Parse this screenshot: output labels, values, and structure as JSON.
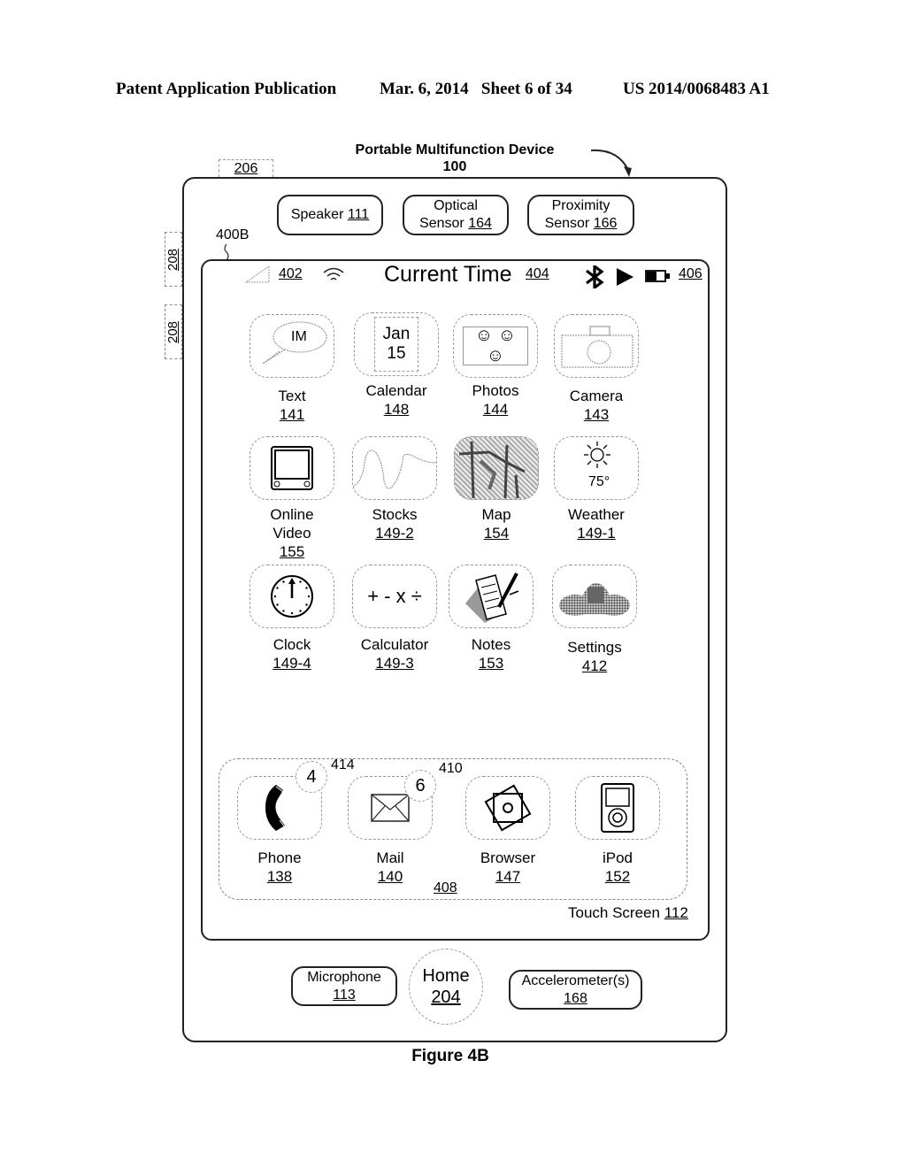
{
  "header": {
    "publication": "Patent Application Publication",
    "date_sheet": "Mar. 6, 2014   Sheet 6 of 34",
    "pub_number": "US 2014/0068483 A1"
  },
  "device": {
    "title": "Portable Multifunction Device",
    "ref": "100",
    "ref_206": "206",
    "side_buttons": [
      "208",
      "208"
    ],
    "screen_ref": "400B",
    "sensors": [
      {
        "line1": "Speaker",
        "ref": "111"
      },
      {
        "line1": "Optical",
        "line2": "Sensor",
        "ref": "164"
      },
      {
        "line1": "Proximity",
        "line2": "Sensor",
        "ref": "166"
      }
    ]
  },
  "status_bar": {
    "signal_ref": "402",
    "time_label": "Current Time",
    "time_ref": "404",
    "battery_ref": "406",
    "icons": [
      "signal-icon",
      "wifi-icon",
      "bluetooth-icon",
      "play-icon",
      "battery-icon"
    ]
  },
  "apps": [
    {
      "name": "Text",
      "ref": "141",
      "icon": "im-bubble-icon",
      "icon_text": "IM"
    },
    {
      "name": "Calendar",
      "ref": "148",
      "icon": "calendar-icon",
      "icon_text": "Jan",
      "icon_text2": "15"
    },
    {
      "name": "Photos",
      "ref": "144",
      "icon": "photos-icon",
      "icon_text": "☺ ☺ ☺"
    },
    {
      "name": "Camera",
      "ref": "143",
      "icon": "camera-icon"
    },
    {
      "name": "Online Video",
      "name1": "Online",
      "name2": "Video",
      "ref": "155",
      "icon": "video-icon"
    },
    {
      "name": "Stocks",
      "ref": "149-2",
      "icon": "stocks-icon"
    },
    {
      "name": "Map",
      "ref": "154",
      "icon": "map-icon"
    },
    {
      "name": "Weather",
      "ref": "149-1",
      "icon": "weather-icon",
      "icon_text": "75°"
    },
    {
      "name": "Clock",
      "ref": "149-4",
      "icon": "clock-icon"
    },
    {
      "name": "Calculator",
      "ref": "149-3",
      "icon": "calculator-icon",
      "icon_text": "+ - x ÷"
    },
    {
      "name": "Notes",
      "ref": "153",
      "icon": "notes-icon"
    },
    {
      "name": "Settings",
      "ref": "412",
      "icon": "settings-icon"
    }
  ],
  "dock": {
    "ref": "408",
    "apps": [
      {
        "name": "Phone",
        "ref": "138",
        "icon": "phone-icon",
        "badge": "4",
        "badge_ref": "414"
      },
      {
        "name": "Mail",
        "ref": "140",
        "icon": "mail-icon",
        "badge": "6",
        "badge_ref": "410"
      },
      {
        "name": "Browser",
        "ref": "147",
        "icon": "browser-icon"
      },
      {
        "name": "iPod",
        "ref": "152",
        "icon": "ipod-icon"
      }
    ]
  },
  "touch_screen": {
    "label": "Touch Screen",
    "ref": "112"
  },
  "bottom": {
    "microphone": {
      "label": "Microphone",
      "ref": "113"
    },
    "home": {
      "label": "Home",
      "ref": "204"
    },
    "accelerometer": {
      "label": "Accelerometer(s)",
      "ref": "168"
    }
  },
  "figure_label": "Figure 4B"
}
